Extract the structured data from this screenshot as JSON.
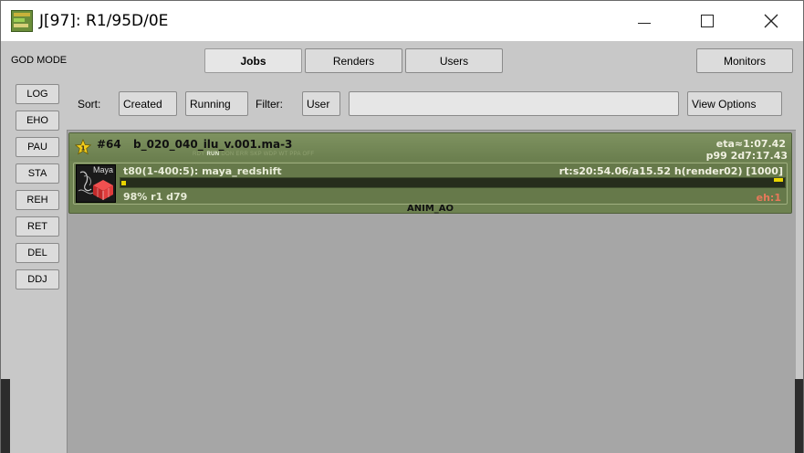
{
  "window": {
    "title": "J[97]: R1/95D/0E",
    "icon": "afanasy-icon"
  },
  "header": {
    "mode_label": "GOD MODE",
    "tabs": [
      {
        "label": "Jobs",
        "active": true
      },
      {
        "label": "Renders",
        "active": false
      },
      {
        "label": "Users",
        "active": false
      }
    ],
    "monitors_label": "Monitors"
  },
  "toolbar": {
    "sort_label": "Sort:",
    "sort_primary": "Created",
    "sort_secondary": "Running",
    "filter_label": "Filter:",
    "filter_type": "User",
    "filter_value": "",
    "view_options_label": "View Options"
  },
  "sidebar": {
    "items": [
      {
        "label": "LOG"
      },
      {
        "label": "EHO"
      },
      {
        "label": "PAU"
      },
      {
        "label": "STA"
      },
      {
        "label": "REH"
      },
      {
        "label": "RET"
      },
      {
        "label": "DEL"
      },
      {
        "label": "DDJ"
      }
    ]
  },
  "job": {
    "priority_badge": "1",
    "number": "#64",
    "name": "b_020_040_ilu_v.001.ma-3",
    "states": {
      "before": "RDY",
      "current": "RUN",
      "after": "DON ERR SKP WDP WT PPA OFF"
    },
    "eta": "eta≈1:07.42",
    "priority_info": "p99 2d7:17.43",
    "user": "ANIM_AO",
    "block": {
      "service_label": "Maya",
      "name": "t80(1-400:5): maya_redshift",
      "info": "rt:s20:54.06/a15.52 h(render02) [1000]",
      "progress_percent": 98,
      "stats": "98% r1 d79",
      "errors": "eh:1"
    },
    "colors": {
      "job_bg": "#6e8251",
      "progress_fill": "#e8d400",
      "error_text": "#e8785a"
    }
  }
}
